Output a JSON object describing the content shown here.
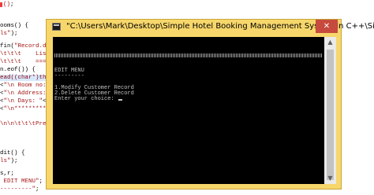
{
  "editor": {
    "lines": [
      {
        "top": "();",
        "parts": []
      },
      {
        "text": "ooms() {"
      },
      {
        "text": "ls\");"
      },
      {
        "text": "fin(\"Record.dat"
      },
      {
        "text": "\\t\\t\\t    List"
      },
      {
        "text": "\\t\\t\\t    ====="
      },
      {
        "text": "n.eof()) {"
      },
      {
        "text": "ead((char*)this,"
      },
      {
        "text": "<\"\\n Room no: \""
      },
      {
        "text": "<\"\\n Address: \""
      },
      {
        "text": "<\"\\n Days: \"<<d"
      },
      {
        "text": "<\"\\n**********"
      },
      {
        "text": "\\n\\n\\t\\t\\tPress"
      },
      {
        "text": "dit() {"
      },
      {
        "text": "ls\");"
      },
      {
        "text": "s,r;"
      },
      {
        "text": " EDIT MENU\";"
      },
      {
        "text": "---------\";"
      }
    ]
  },
  "window": {
    "title": "\"C:\\Users\\Mark\\Desktop\\Simple Hotel Booking Management System in C++\\Si...",
    "close_label": "✕"
  },
  "console": {
    "lines": [
      "EDIT MENU",
      "---------",
      "",
      "1.Modify Customer Record",
      "2.Delete Customer Record",
      "Enter your choice: "
    ]
  },
  "scrollbar": {
    "up_icon": "▲",
    "down_icon": "▼"
  }
}
